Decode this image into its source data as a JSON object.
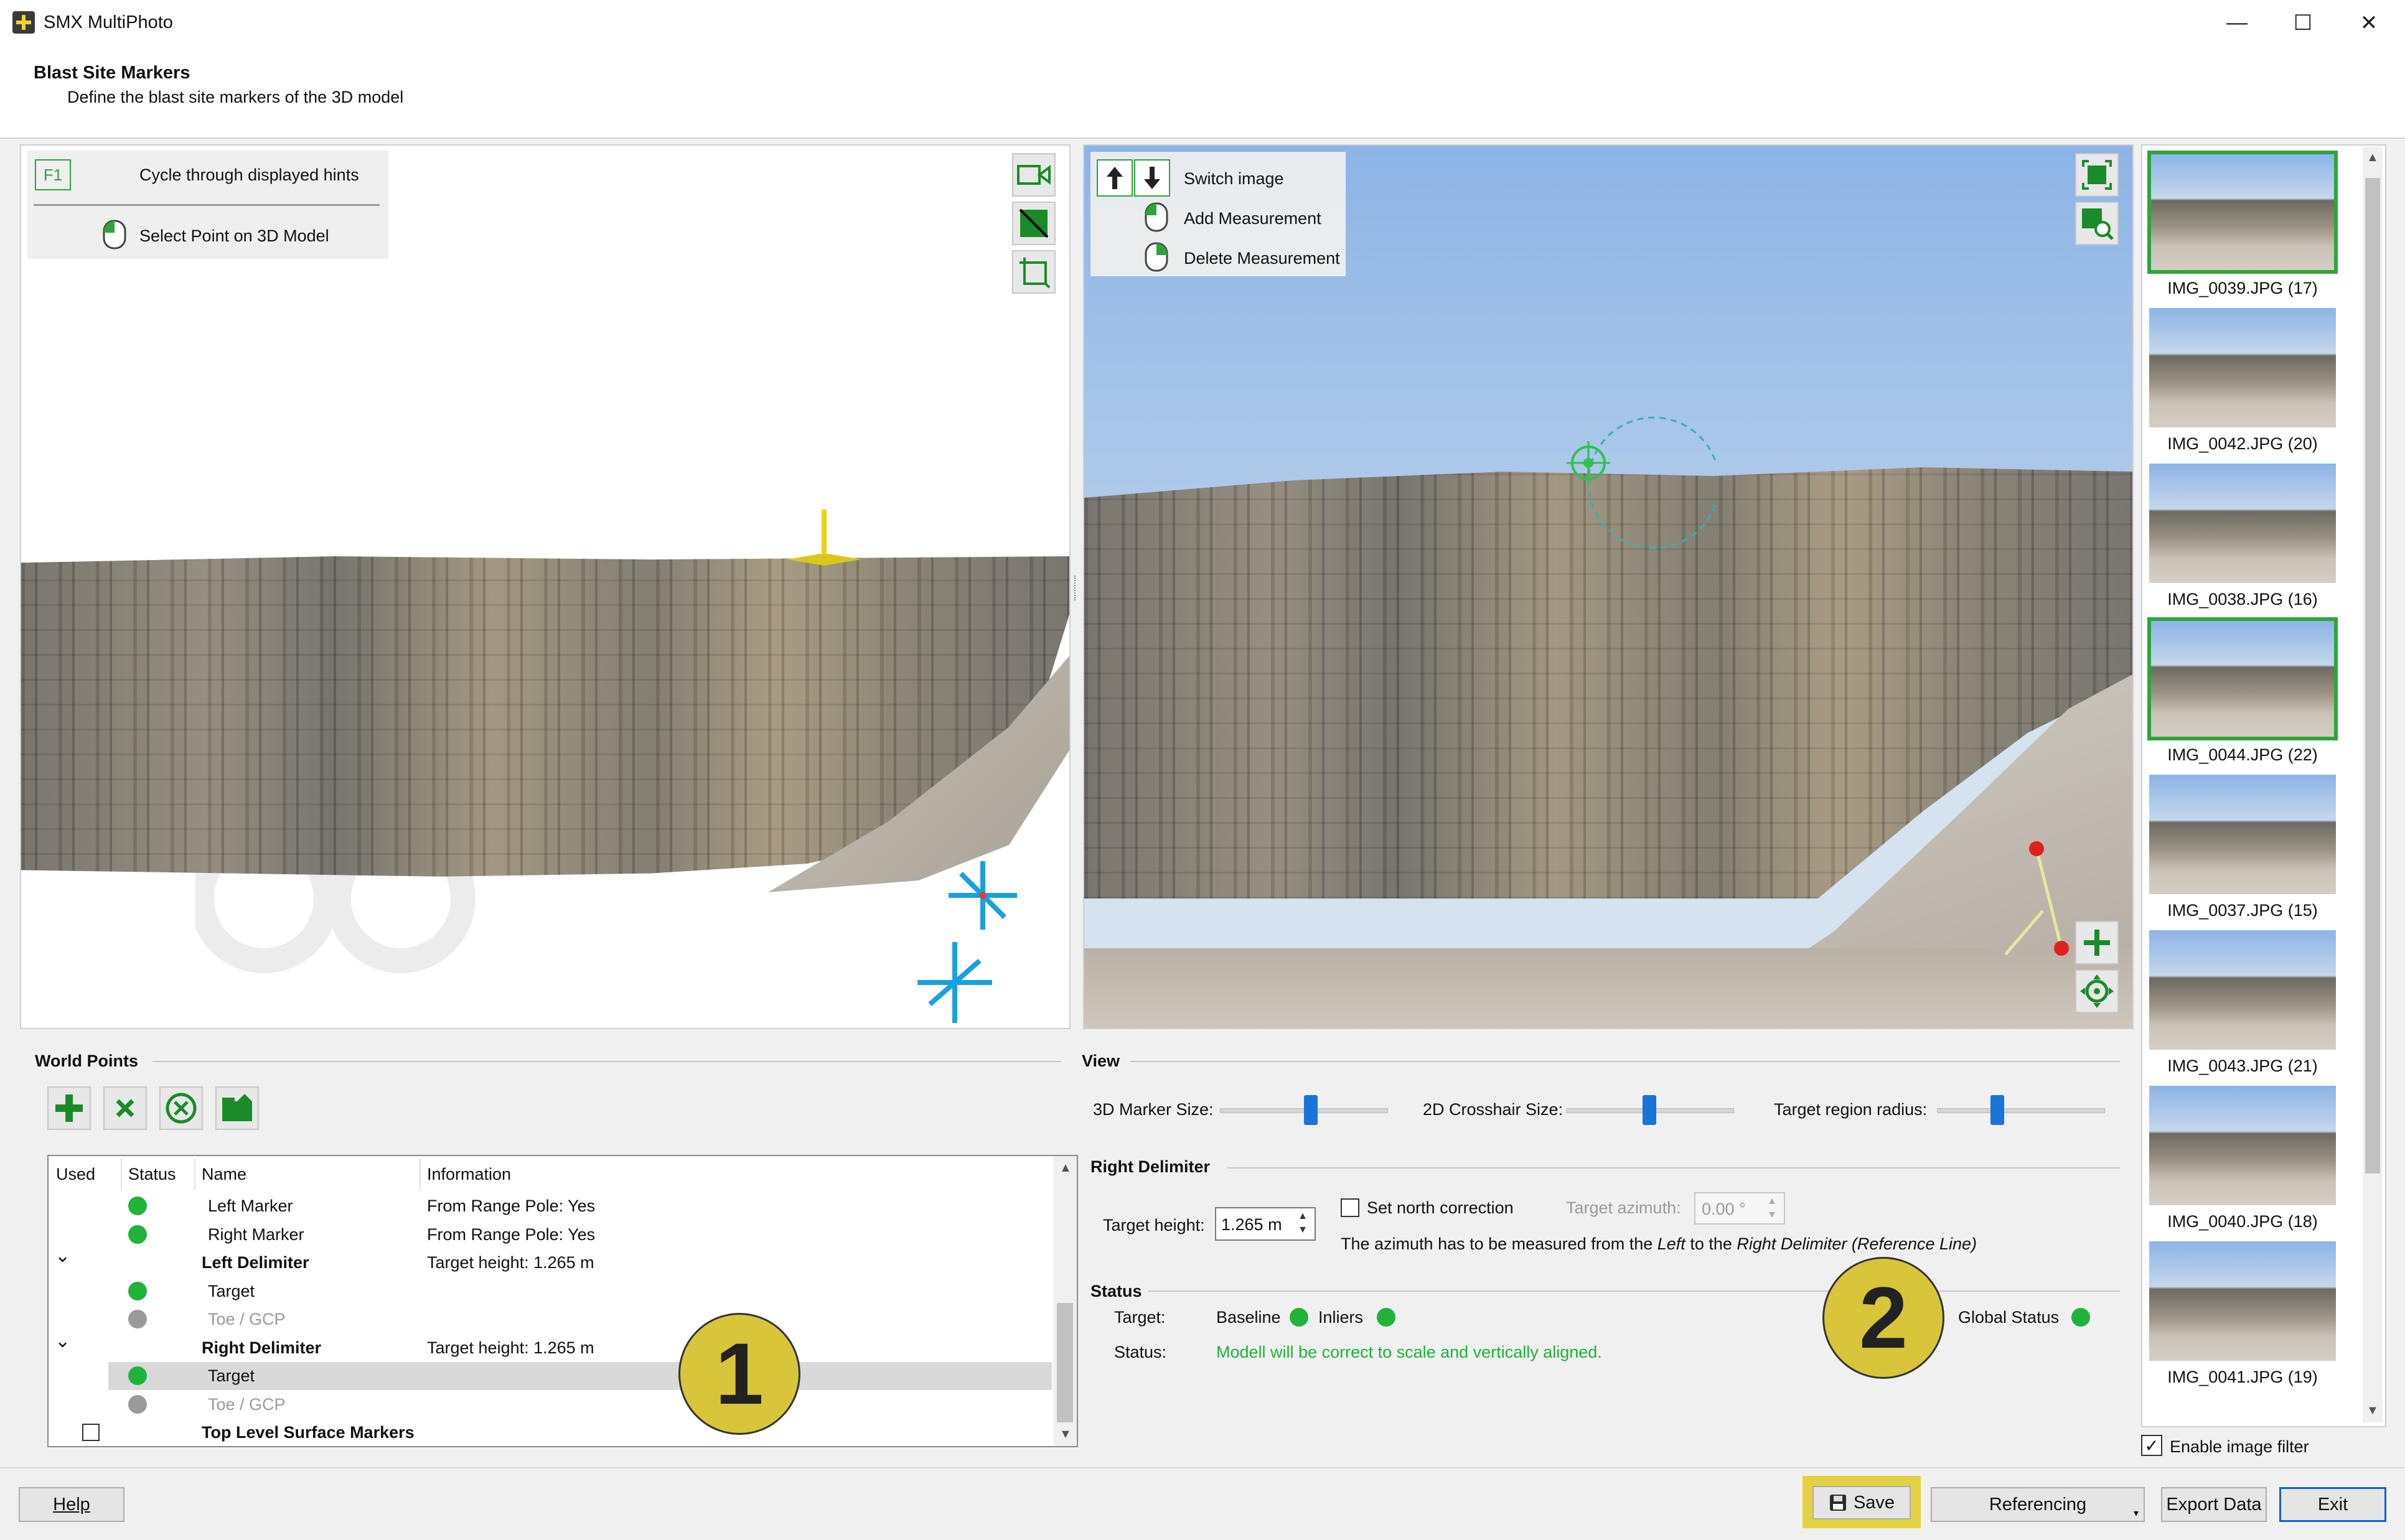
{
  "window": {
    "title": "SMX MultiPhoto",
    "controls": [
      "—",
      "☐",
      "✕"
    ]
  },
  "header": {
    "title": "Blast Site Markers",
    "subtitle": "Define the blast site markers of the 3D model"
  },
  "model_view": {
    "hints": {
      "key": "F1",
      "cycle_label": "Cycle through displayed hints",
      "select_label": "Select Point on 3D Model"
    },
    "tools": [
      "video-camera-icon",
      "diagonal-view-icon",
      "crop-frame-icon"
    ]
  },
  "image_view": {
    "hints": {
      "switch_label": "Switch image",
      "add_label": "Add Measurement",
      "delete_label": "Delete Measurement"
    },
    "tools": [
      "fit-view-icon",
      "zoom-image-icon",
      "add-point-icon",
      "center-target-icon"
    ]
  },
  "thumbnails": [
    {
      "label": "IMG_0039.JPG (17)",
      "state": "current"
    },
    {
      "label": "IMG_0042.JPG (20)",
      "state": ""
    },
    {
      "label": "IMG_0038.JPG (16)",
      "state": ""
    },
    {
      "label": "IMG_0044.JPG (22)",
      "state": "used"
    },
    {
      "label": "IMG_0037.JPG (15)",
      "state": ""
    },
    {
      "label": "IMG_0043.JPG (21)",
      "state": ""
    },
    {
      "label": "IMG_0040.JPG (18)",
      "state": ""
    },
    {
      "label": "IMG_0041.JPG (19)",
      "state": ""
    }
  ],
  "image_filter": {
    "label": "Enable image filter",
    "checked": true
  },
  "world_points": {
    "title": "World Points",
    "toolbar": [
      "add-icon",
      "delete-icon",
      "clear-icon",
      "import-icon"
    ],
    "columns": {
      "used": "Used",
      "status": "Status",
      "name": "Name",
      "information": "Information"
    },
    "rows": [
      {
        "indent": 1,
        "status": "green",
        "name": "Left Marker",
        "info": "From Range Pole: Yes",
        "bold": false,
        "dim": false,
        "expander": ""
      },
      {
        "indent": 1,
        "status": "green",
        "name": "Right Marker",
        "info": "From Range Pole: Yes",
        "bold": false,
        "dim": false,
        "expander": ""
      },
      {
        "indent": 0,
        "status": "",
        "name": "Left Delimiter",
        "info": "Target height: 1.265 m",
        "bold": true,
        "dim": false,
        "expander": "⌄"
      },
      {
        "indent": 1,
        "status": "green",
        "name": "Target",
        "info": "",
        "bold": false,
        "dim": false,
        "expander": ""
      },
      {
        "indent": 1,
        "status": "grey",
        "name": "Toe / GCP",
        "info": "",
        "bold": false,
        "dim": true,
        "expander": ""
      },
      {
        "indent": 0,
        "status": "",
        "name": "Right Delimiter",
        "info": "Target height: 1.265 m",
        "bold": true,
        "dim": false,
        "expander": "⌄"
      },
      {
        "indent": 1,
        "status": "green",
        "name": "Target",
        "info": "",
        "bold": false,
        "dim": false,
        "expander": "",
        "selected": true
      },
      {
        "indent": 1,
        "status": "grey",
        "name": "Toe / GCP",
        "info": "",
        "bold": false,
        "dim": true,
        "expander": ""
      },
      {
        "indent": 0,
        "status": "",
        "name": "Top Level Surface Markers",
        "info": "",
        "bold": true,
        "dim": false,
        "expander": "",
        "checkbox": true
      }
    ]
  },
  "view": {
    "title": "View",
    "marker_label": "3D Marker Size:",
    "marker_value": 0.55,
    "crosshair_label": "2D Crosshair Size:",
    "crosshair_value": 0.5,
    "region_label": "Target region radius:",
    "region_value": 0.35
  },
  "right_delimiter": {
    "title": "Right Delimiter",
    "height_label": "Target height:",
    "height_value": "1.265 m",
    "north_label": "Set north correction",
    "azimuth_label": "Target azimuth:",
    "azimuth_value": "0.00 °",
    "note_prefix": "The azimuth has to be measured from the ",
    "note_left": "Left",
    "note_mid": " to the ",
    "note_right": "Right Delimiter (Reference Line)"
  },
  "status": {
    "title": "Status",
    "target_label": "Target:",
    "baseline_label": "Baseline",
    "inliers_label": "Inliers",
    "global_label": "Global Status",
    "status_label": "Status:",
    "status_message": "Modell will be correct to scale and vertically aligned."
  },
  "callouts": [
    "1",
    "2"
  ],
  "footer": {
    "help": "Help",
    "save": "Save",
    "referencing": "Referencing",
    "export": "Export Data",
    "exit": "Exit"
  },
  "colors": {
    "accent": "#2ea43a",
    "status_green": "#1fb33a",
    "callout": "#d8c53a",
    "selection": "#0a64d8"
  }
}
